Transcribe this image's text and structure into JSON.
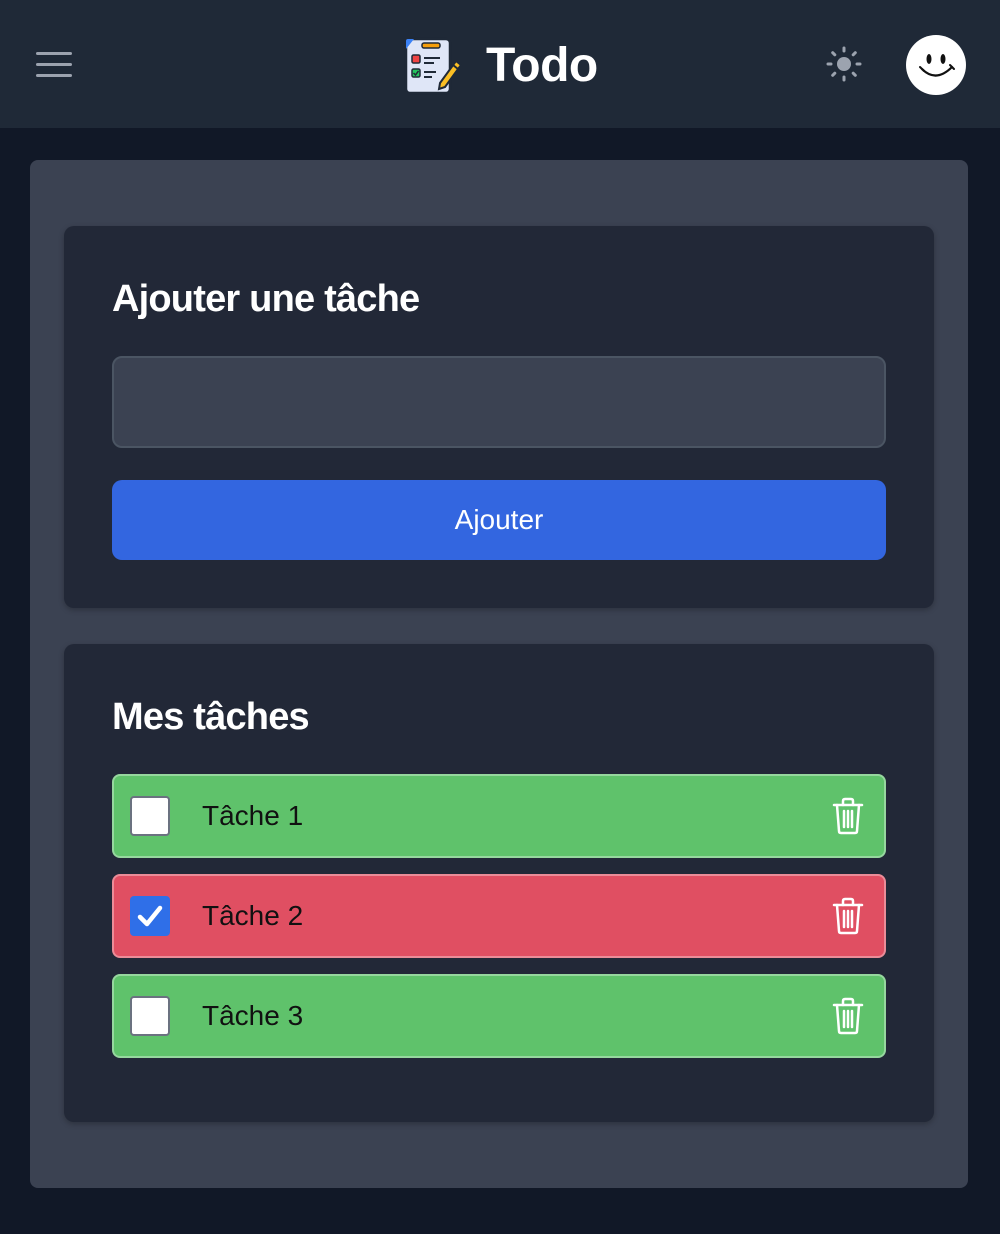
{
  "header": {
    "title": "Todo",
    "menu_icon": "hamburger-menu-icon",
    "logo_icon": "checklist-clipboard-icon",
    "theme_icon": "sun-icon",
    "avatar_icon": "smiley-face-icon"
  },
  "add_card": {
    "heading": "Ajouter une tâche",
    "input_value": "",
    "input_placeholder": "",
    "button_label": "Ajouter"
  },
  "list_card": {
    "heading": "Mes tâches",
    "tasks": [
      {
        "label": "Tâche 1",
        "done": false,
        "color": "#5fc26b"
      },
      {
        "label": "Tâche 2",
        "done": true,
        "color": "#e04f62"
      },
      {
        "label": "Tâche 3",
        "done": false,
        "color": "#5fc26b"
      }
    ]
  },
  "colors": {
    "accent": "#3366e0",
    "task_open": "#5fc26b",
    "task_done": "#e04f62"
  }
}
